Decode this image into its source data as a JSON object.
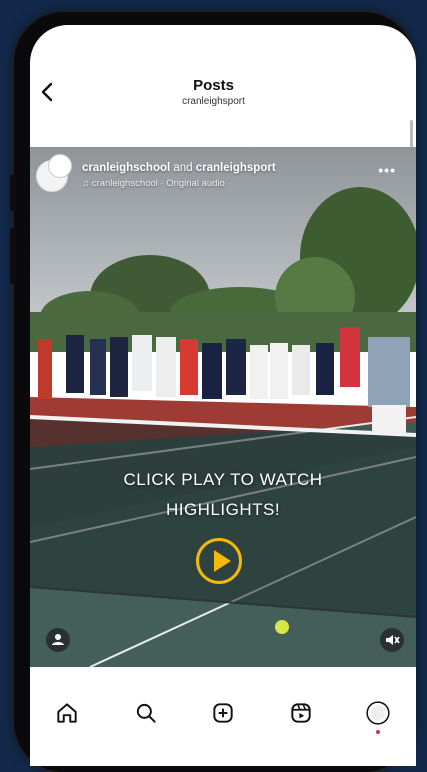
{
  "header": {
    "title": "Posts",
    "subtitle": "cranleighsport",
    "back_icon": "chevron-left-icon"
  },
  "post": {
    "author_primary": "cranleighschool",
    "author_joiner": " and ",
    "author_secondary": "cranleighsport",
    "audio_line": "cranleighschool · Original audio",
    "music_icon": "music-note-icon",
    "more_icon": "more-horizontal-icon"
  },
  "video": {
    "cta_line1": "CLICK PLAY TO WATCH",
    "cta_line2": "HIGHLIGHTS!",
    "play_icon": "play-icon",
    "accent_color": "#f5b90a",
    "tag_icon": "person-tag-icon",
    "mute_icon": "speaker-muted-icon"
  },
  "tabbar": {
    "items": [
      {
        "name": "home",
        "icon": "home-icon"
      },
      {
        "name": "search",
        "icon": "search-icon"
      },
      {
        "name": "create",
        "icon": "plus-square-icon"
      },
      {
        "name": "reels",
        "icon": "reels-icon"
      },
      {
        "name": "profile",
        "icon": "profile-avatar-icon"
      }
    ],
    "notification_color": "#e0245e"
  },
  "colors": {
    "background": "#13294b",
    "court": "#3f5a55",
    "court_outer": "#9e3b34"
  }
}
